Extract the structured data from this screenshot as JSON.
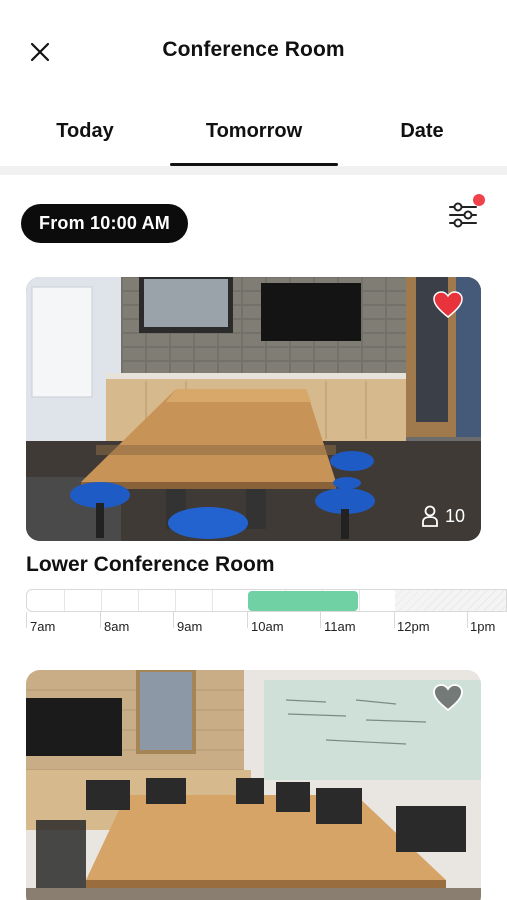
{
  "header": {
    "title": "Conference Room",
    "close_icon": "close-icon"
  },
  "tabs": [
    {
      "label": "Today",
      "active": false
    },
    {
      "label": "Tomorrow",
      "active": true
    },
    {
      "label": "Date",
      "active": false
    }
  ],
  "filter": {
    "from_label": "From 10:00 AM",
    "filter_icon": "sliders-icon",
    "notification_dot": true,
    "dot_color": "#f0424b"
  },
  "rooms": [
    {
      "name": "Lower Conference Room",
      "capacity": "10",
      "favorited": true,
      "heart_color": "#e8323c",
      "timeline": {
        "labels": [
          "7am",
          "8am",
          "9am",
          "10am",
          "11am",
          "12pm",
          "1pm"
        ],
        "booked_start_hour": 10,
        "booked_end_hour": 11.5,
        "booked_color": "#6fd1a4"
      }
    },
    {
      "favorited": false
    }
  ]
}
